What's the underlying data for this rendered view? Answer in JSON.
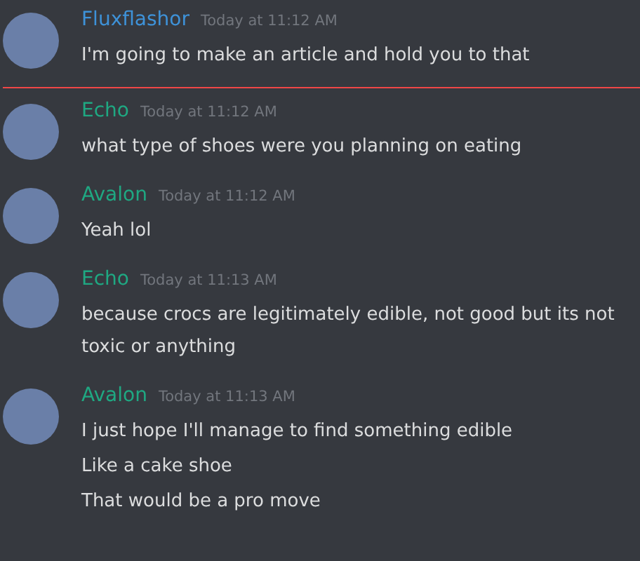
{
  "messages": [
    {
      "author": "Fluxflashor",
      "color": "#3e92d8",
      "timestamp": "Today at 11:12 AM",
      "lines": [
        "I'm going to make an article and hold you to that"
      ],
      "new_divider_below": true
    },
    {
      "author": "Echo",
      "color": "#1fa882",
      "timestamp": "Today at 11:12 AM",
      "lines": [
        "what type of shoes were you planning on eating"
      ],
      "new_divider_below": false
    },
    {
      "author": "Avalon",
      "color": "#1fa882",
      "timestamp": "Today at 11:12 AM",
      "lines": [
        "Yeah lol"
      ],
      "new_divider_below": false
    },
    {
      "author": "Echo",
      "color": "#1fa882",
      "timestamp": "Today at 11:13 AM",
      "lines": [
        "because crocs are legitimately edible, not good but its not toxic or anything"
      ],
      "new_divider_below": false
    },
    {
      "author": "Avalon",
      "color": "#1fa882",
      "timestamp": "Today at 11:13 AM",
      "lines": [
        "I just hope I'll manage to find something edible",
        "Like a cake shoe",
        "That would be a pro move"
      ],
      "new_divider_below": false
    }
  ]
}
